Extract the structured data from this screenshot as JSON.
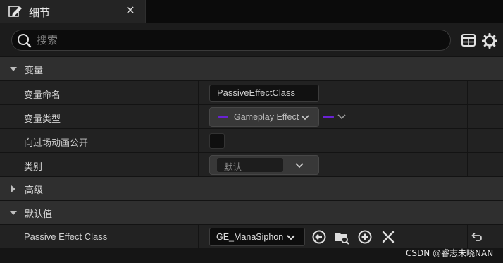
{
  "tab": {
    "title": "细节",
    "close_glyph": "✕",
    "icon": "pencil-note-icon"
  },
  "search": {
    "placeholder": "搜索",
    "value": ""
  },
  "toolbar": {
    "table_icon": "table-icon",
    "settings_icon": "gear-icon"
  },
  "sections": {
    "variables": {
      "label": "变量",
      "expanded": true
    },
    "advanced": {
      "label": "高级",
      "expanded": false
    },
    "default_value": {
      "label": "默认值",
      "expanded": true
    }
  },
  "properties": {
    "var_name": {
      "label": "变量命名",
      "value": "PassiveEffectClass"
    },
    "var_type": {
      "label": "变量类型",
      "value": "Gameplay Effect",
      "pin_color": "#6a22d4"
    },
    "expose_cinematic": {
      "label": "向过场动画公开",
      "checked": false
    },
    "category": {
      "label": "类别",
      "value": "默认"
    }
  },
  "defaults": {
    "passive_effect_class": {
      "label": "Passive Effect Class",
      "value": "GE_ManaSiphon"
    }
  },
  "watermark": "CSDN @睿志未晓NAN"
}
